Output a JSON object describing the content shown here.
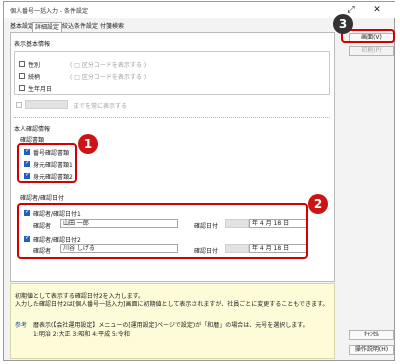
{
  "window": {
    "title": "個人番号一括入力 - 条件設定",
    "expand_glyph": "⤢",
    "close_glyph": "✕"
  },
  "tabs": [
    {
      "label": "基本設定",
      "active": false
    },
    {
      "label": "詳細設定",
      "active": true
    },
    {
      "label": "絞込条件設定",
      "active": false
    },
    {
      "label": "付箋検索",
      "active": false
    }
  ],
  "display_basic": {
    "heading": "表示基本情報",
    "items": [
      {
        "label": "性別",
        "checked": false,
        "note": "(  □ 区分コードを表示する  )"
      },
      {
        "label": "続柄",
        "checked": false,
        "note": "(  □ 区分コードを表示する  )"
      },
      {
        "label": "生年月日",
        "checked": false
      }
    ],
    "until_label": "までを常に表示する"
  },
  "identity": {
    "heading": "本人確認情報",
    "docs_heading": "確認書類",
    "docs": [
      {
        "label": "番号確認書類",
        "checked": true
      },
      {
        "label": "身元確認書類1",
        "checked": true
      },
      {
        "label": "身元確認書類2",
        "checked": true
      }
    ],
    "confirmer_heading": "確認者/確認日付",
    "rows": [
      {
        "label": "確認者/確認日付1",
        "checked": true,
        "person_label": "確認者",
        "person_value": "山田 一郎",
        "date_label": "確認日付",
        "year_value": "年  4 月 18 日"
      },
      {
        "label": "確認者/確認日付2",
        "checked": true,
        "person_label": "確認者",
        "person_value": "川谷 しげる",
        "date_label": "確認日付",
        "year_value": "年  4 月 18 日"
      }
    ]
  },
  "side_buttons": {
    "screen": "画面(V)",
    "print": "印刷(P)",
    "cancel": "ｷｬﾝｾﾙ",
    "manual": "操作説明(H)"
  },
  "info": {
    "line1": "初期値として表示する確認日付2を入力します。",
    "line2": "入力した確認日付2は[個人番号一括入力]画面に初期値として表示されますが、社員ごとに変更することもできます。",
    "ref_label": "参考",
    "ref_line1": "暦表示(【会社運用設定】メニューの[運用設定]ページで設定)が「和暦」の場合は、元号を選択します。",
    "ref_line2": "1:明治  2:大正  3:昭和  4:平成  5:令和"
  },
  "callouts": {
    "one": "1",
    "two": "2",
    "three": "3"
  },
  "colors": {
    "accent_red": "#d40000",
    "check_blue": "#1f5fbf",
    "info_bg": "#fdfbd8"
  }
}
